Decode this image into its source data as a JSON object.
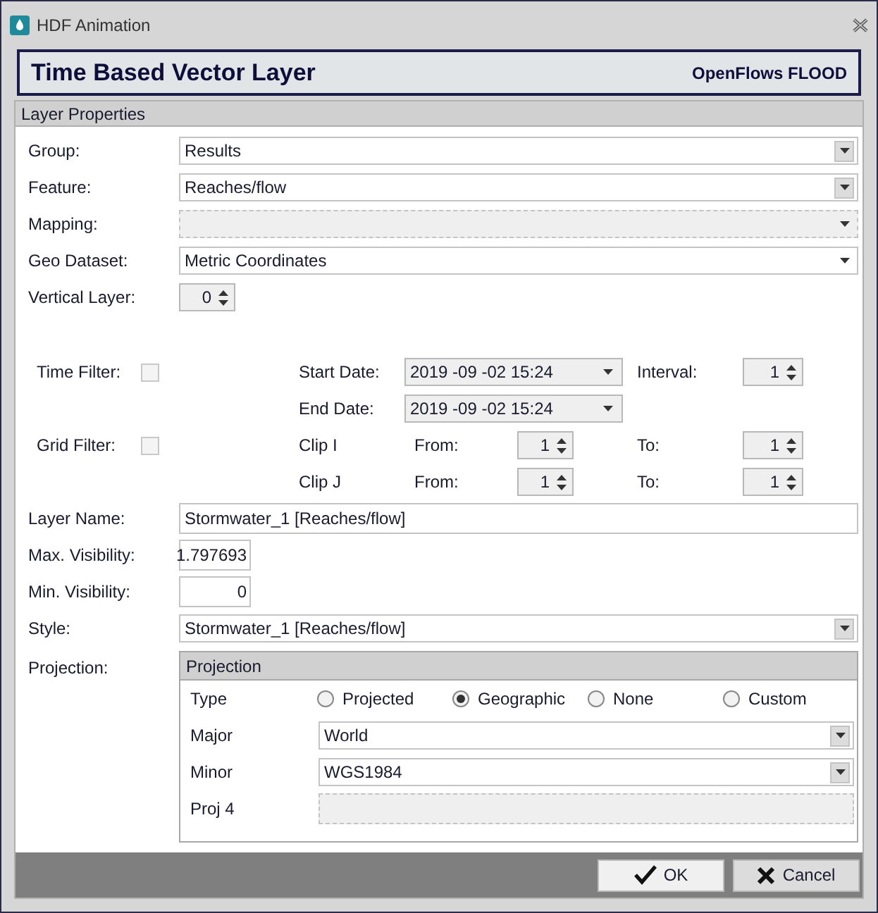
{
  "window": {
    "title": "HDF Animation"
  },
  "header": {
    "title": "Time Based Vector Layer",
    "product": "OpenFlows FLOOD"
  },
  "section": {
    "title": "Layer Properties"
  },
  "fields": [
    {
      "label": "Group:",
      "kind": "dropdown",
      "value": "Results",
      "disabled": false
    },
    {
      "label": "Feature:",
      "kind": "dropdown",
      "value": "Reaches/flow",
      "disabled": false
    },
    {
      "label": "Mapping:",
      "kind": "combo",
      "disabled": true
    },
    {
      "label": "Geo Dataset:",
      "kind": "combo",
      "value": "Metric Coordinates",
      "disabled": false
    },
    {
      "label": "Vertical Layer:",
      "kind": "spinner",
      "value": "0",
      "disabled": false
    }
  ],
  "filters": {
    "time_filter": {
      "label": "Time Filter:",
      "checked": false
    },
    "start_date": {
      "label": "Start Date:",
      "value": "2019 -09 -02 15:24"
    },
    "interval": {
      "label": "Interval:",
      "value": "1"
    },
    "end_date": {
      "label": "End Date:",
      "value": "2019 -09 -02 15:24"
    },
    "grid_filter": {
      "label": "Grid Filter:",
      "checked": false
    },
    "clips": [
      {
        "label": "Clip I",
        "from_label": "From:",
        "from": "1",
        "to_label": "To:",
        "to": "1"
      },
      {
        "label": "Clip J",
        "from_label": "From:",
        "from": "1",
        "to_label": "To:",
        "to": "1"
      }
    ]
  },
  "fields2": [
    {
      "label": "Layer Name:",
      "kind": "text",
      "value": "Stormwater_1 [Reaches/flow]",
      "disabled": false
    },
    {
      "label": "Max. Visibility:",
      "kind": "number",
      "value": "1.797693",
      "disabled": false
    },
    {
      "label": "Min. Visibility:",
      "kind": "number",
      "value": "0",
      "disabled": false
    },
    {
      "label": "Style:",
      "kind": "dropdown",
      "value": "Stormwater_1 [Reaches/flow]",
      "disabled": false
    }
  ],
  "projection": {
    "label": "Projection:",
    "title": "Projection",
    "type_label": "Type",
    "options": [
      {
        "label": "Projected",
        "selected": false
      },
      {
        "label": "Geographic",
        "selected": true
      },
      {
        "label": "None",
        "selected": false
      },
      {
        "label": "Custom",
        "selected": false
      }
    ],
    "rows": [
      {
        "label": "Major",
        "kind": "dropdown",
        "value": "World",
        "disabled": false
      },
      {
        "label": "Minor",
        "kind": "dropdown",
        "value": "WGS1984",
        "disabled": false
      },
      {
        "label": "Proj 4",
        "kind": "text",
        "disabled": true
      }
    ]
  },
  "buttons": [
    {
      "kind": "ok",
      "label": "OK"
    },
    {
      "kind": "cancel",
      "label": "Cancel"
    }
  ]
}
